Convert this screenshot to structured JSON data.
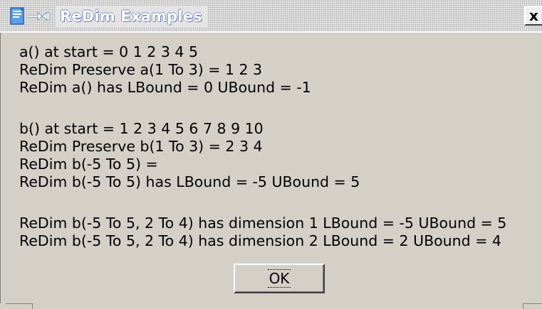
{
  "window": {
    "title": "ReDim Examples",
    "icon": "document-icon",
    "pin_icon": "pin-icon",
    "close_label": "x"
  },
  "output": {
    "lines": [
      "a() at start = 0 1 2 3 4 5",
      "ReDim Preserve a(1 To 3) = 1 2 3",
      "ReDim a() has LBound = 0 UBound = -1",
      "b() at start = 1 2 3 4 5 6 7 8 9 10",
      "ReDim Preserve b(1 To 3) = 2 3 4",
      "ReDim b(-5 To 5) =",
      "ReDim b(-5 To 5) has LBound = -5 UBound = 5",
      "ReDim b(-5 To 5, 2 To 4) has dimension 1 LBound = -5 UBound = 5",
      "ReDim b(-5 To 5, 2 To 4) has dimension 2 LBound = 2 UBound = 4"
    ]
  },
  "buttons": {
    "ok_label": "OK"
  },
  "colors": {
    "window_background": "#d4d0c8",
    "title_text": "#ffffff",
    "text": "#000000"
  }
}
